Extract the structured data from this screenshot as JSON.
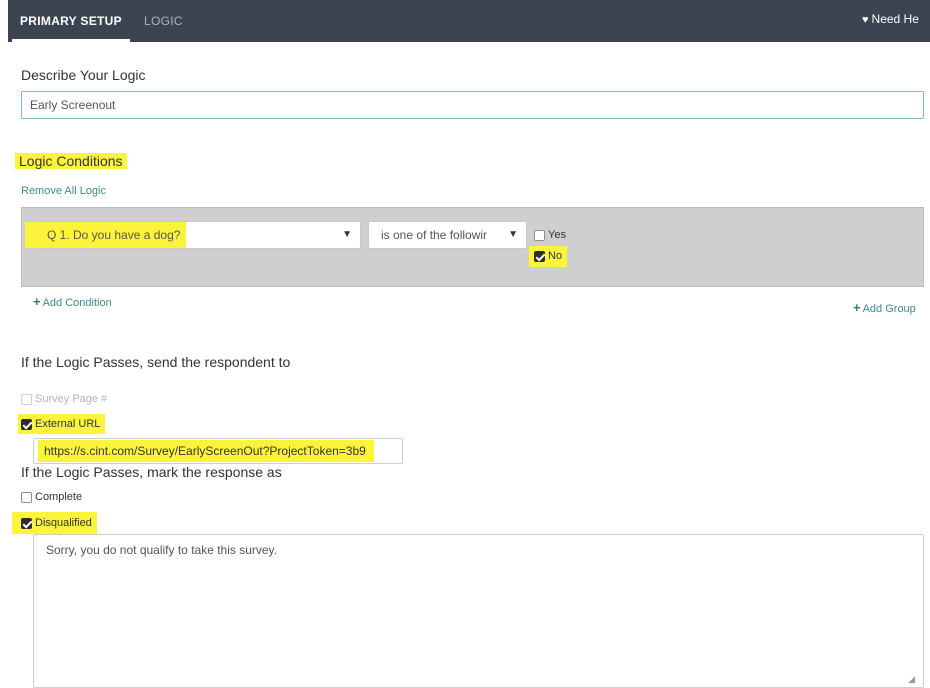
{
  "nav": {
    "tabs": [
      {
        "label": "PRIMARY SETUP",
        "active": true
      },
      {
        "label": "LOGIC",
        "active": false
      }
    ],
    "help_label": "Need He",
    "help_icon": "heart-icon"
  },
  "describe": {
    "label": "Describe Your Logic",
    "value": "Early Screenout"
  },
  "conditions": {
    "heading": "Logic Conditions",
    "remove_all_label": "Remove All Logic",
    "rows": [
      {
        "question": "Q 1. Do you have a dog?",
        "operator": "is one of the followir",
        "options": [
          {
            "label": "Yes",
            "checked": false
          },
          {
            "label": "No",
            "checked": true
          }
        ]
      }
    ],
    "add_condition_label": "Add Condition",
    "add_group_label": "Add Group"
  },
  "destination": {
    "heading": "If the Logic Passes, send the respondent to",
    "options": [
      {
        "label": "Survey Page #",
        "checked": false,
        "disabled": true
      },
      {
        "label": "External URL",
        "checked": true,
        "disabled": false
      }
    ],
    "url_value": "https://s.cint.com/Survey/EarlyScreenOut?ProjectToken=3b9"
  },
  "response": {
    "heading": "If the Logic Passes, mark the response as",
    "options": [
      {
        "label": "Complete",
        "checked": false
      },
      {
        "label": "Disqualified",
        "checked": true
      }
    ],
    "message": "Sorry, you do not qualify to take this survey."
  },
  "colors": {
    "nav_bg": "#3d4451",
    "highlight": "#fbf43b",
    "link": "#3c8b8f",
    "condition_bg": "#cfcfcf"
  }
}
